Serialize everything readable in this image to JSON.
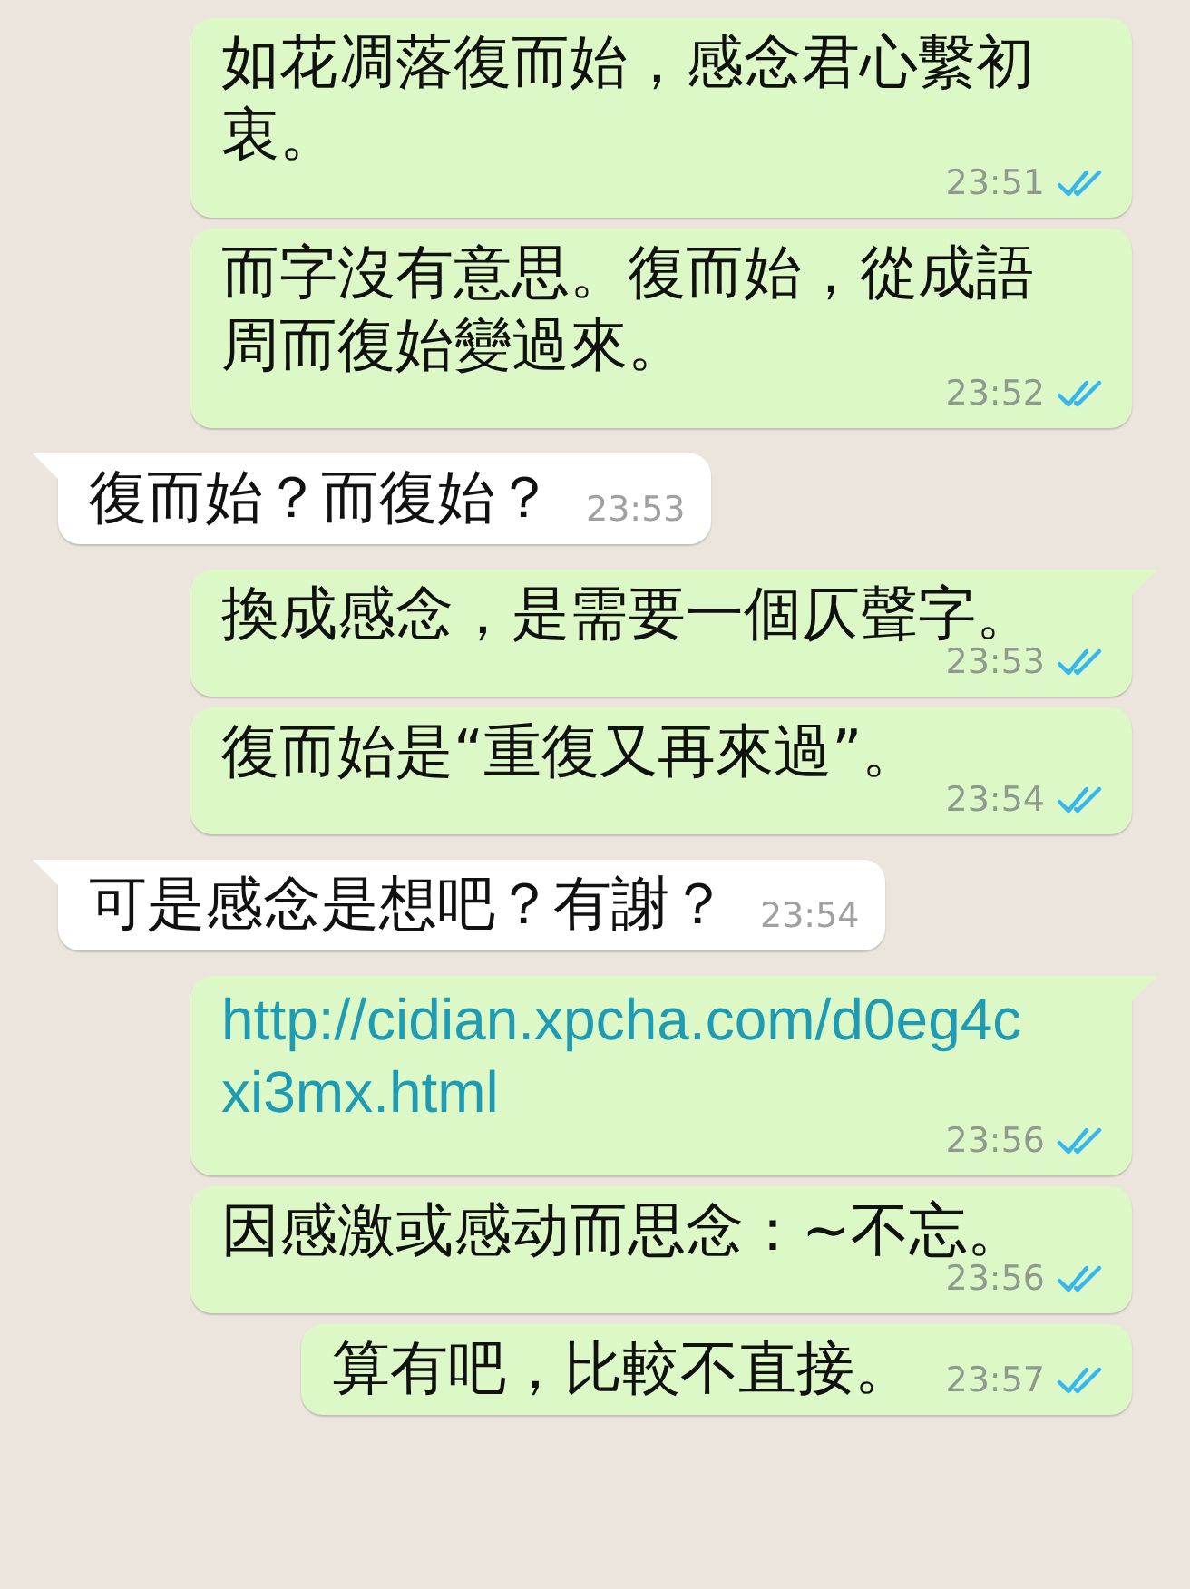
{
  "messages": [
    {
      "kind": "out",
      "tail": false,
      "text": "如花凋落復而始，感念君心繫初衷。",
      "time": "23:51",
      "read": true
    },
    {
      "kind": "out",
      "tail": false,
      "text": "而字沒有意思。復而始，從成語周而復始變過來。",
      "time": "23:52",
      "read": true
    },
    {
      "kind": "in",
      "tail": true,
      "text": "復而始？而復始？",
      "time": "23:53"
    },
    {
      "kind": "out",
      "tail": true,
      "text": "換成感念，是需要一個仄聲字。",
      "time": "23:53",
      "read": true
    },
    {
      "kind": "out",
      "tail": false,
      "text": "復而始是“重復又再來過”。",
      "time": "23:54",
      "read": true
    },
    {
      "kind": "in",
      "tail": true,
      "text": "可是感念是想吧？有謝？",
      "time": "23:54"
    },
    {
      "kind": "link",
      "tail": true,
      "text": "http://cidian.xpcha.com/d0eg4cxi3mx.html",
      "time": "23:56",
      "read": true
    },
    {
      "kind": "out",
      "tail": false,
      "text": "因感激或感动而思念：~不忘。",
      "time": "23:56",
      "read": true
    },
    {
      "kind": "out",
      "tail": false,
      "text": "算有吧，比較不直接。",
      "time": "23:57",
      "read": true
    }
  ]
}
